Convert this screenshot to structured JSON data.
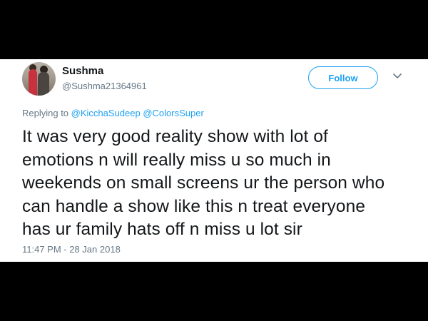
{
  "user": {
    "name": "Sushma",
    "handle": "@Sushma21364961"
  },
  "follow_button": {
    "label": "Follow"
  },
  "more_menu": {
    "icon": "chevron-down-icon"
  },
  "reply": {
    "prefix": "Replying to",
    "mentions": [
      "@KicchaSudeep",
      "@ColorsSuper"
    ]
  },
  "tweet": {
    "lines": [
      "It was very good reality show with lot of",
      "emotions n will really miss u so much in",
      "weekends on small screens ur the person who",
      "can handle a show like this n treat everyone",
      "has ur family hats off n miss u lot sir"
    ],
    "timestamp": "11:47 PM - 28 Jan 2018"
  },
  "colors": {
    "accent": "#1da1f2",
    "text": "#14171a",
    "muted": "#657786",
    "letterbox": "#000000"
  }
}
